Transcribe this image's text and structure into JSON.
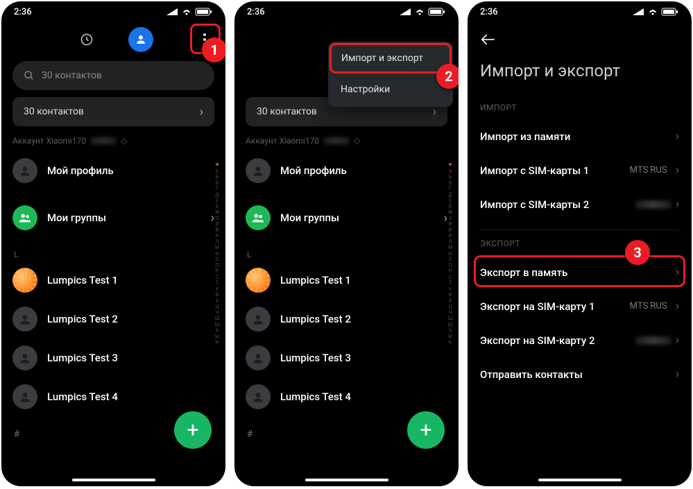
{
  "statusbar": {
    "time": "2:36"
  },
  "search": {
    "placeholder": "30 контактов"
  },
  "count_pill": "30 контактов",
  "account": {
    "prefix": "Аккаунт Xiaomi170"
  },
  "profile_label": "Мой профиль",
  "groups_label": "Мои группы",
  "section_letter": "L",
  "contacts": [
    "Lumpics Test 1",
    "Lumpics Test 2",
    "Lumpics Test 3",
    "Lumpics Test 4"
  ],
  "section_symbol": "#",
  "alpha": "АБВГДЕЁЖЗИЙКЛМНОПРСТУФХЦЧШЩЪЫЬ",
  "popup": {
    "item1": "Импорт и экспорт",
    "item2": "Настройки"
  },
  "callouts": {
    "n1": "1",
    "n2": "2",
    "n3": "3"
  },
  "screen3": {
    "title": "Импорт и экспорт",
    "import_header": "ИМПОРТ",
    "import_storage": "Импорт из памяти",
    "import_sim1": "Импорт с SIM-карты 1",
    "import_sim2": "Импорт с SIM-карты 2",
    "export_header": "ЭКСПОРТ",
    "export_storage": "Экспорт в память",
    "export_sim1": "Экспорт на SIM-карту 1",
    "export_sim2": "Экспорт на SIM-карту 2",
    "send": "Отправить контакты",
    "sim1_sub": "MTS RUS"
  }
}
